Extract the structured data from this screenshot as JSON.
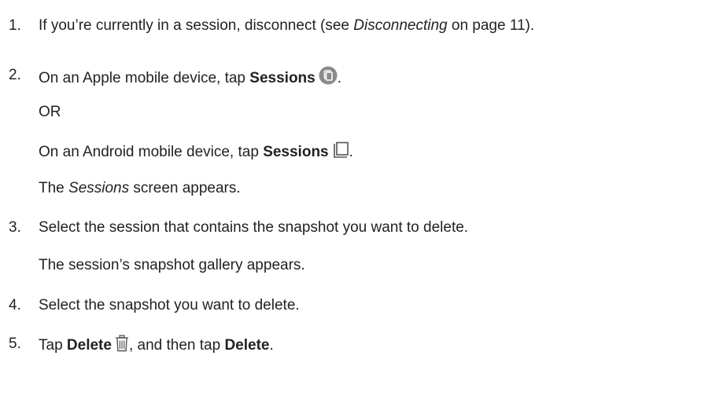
{
  "steps": {
    "s1": {
      "number": "1.",
      "text_a": "If you’re currently in a session, disconnect (see ",
      "text_italic": "Disconnecting",
      "text_b": " on page 11)."
    },
    "s2": {
      "number": "2.",
      "text_a": "On an Apple mobile device, tap ",
      "bold": "Sessions",
      "text_b": ".",
      "or": "OR",
      "android_a": "On an Android mobile device, tap ",
      "android_bold": "Sessions",
      "android_b": ".",
      "result_a": "The ",
      "result_italic": "Sessions",
      "result_b": " screen appears."
    },
    "s3": {
      "number": "3.",
      "text": "Select the session that contains the snapshot you want to delete.",
      "result": "The session’s snapshot gallery appears."
    },
    "s4": {
      "number": "4.",
      "text": "Select the snapshot you want to delete."
    },
    "s5": {
      "number": "5.",
      "text_a": "Tap ",
      "bold1": "Delete",
      "text_b": ", and then tap ",
      "bold2": "Delete",
      "text_c": "."
    }
  },
  "icons": {
    "apple_sessions": "sessions-circle-icon",
    "android_sessions": "sessions-outline-icon",
    "delete": "trash-icon"
  }
}
